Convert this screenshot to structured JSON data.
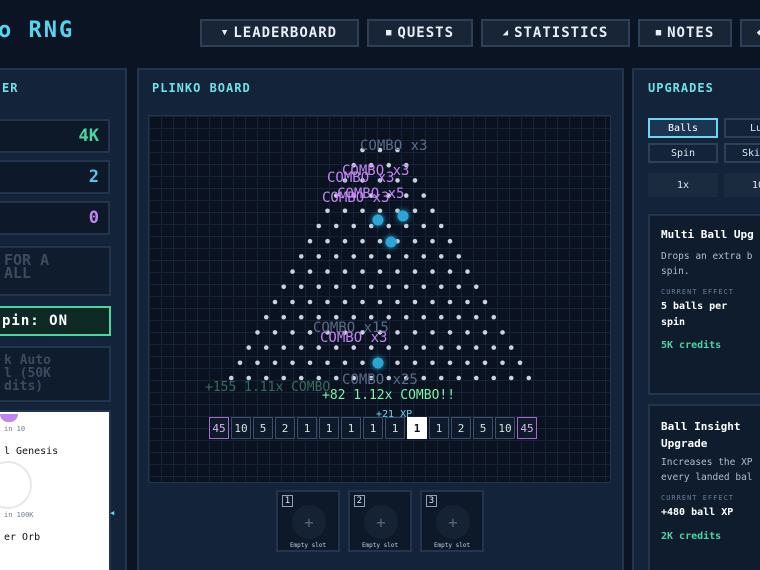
{
  "header": {
    "logo": "o RNG",
    "nav": [
      {
        "label": "LEADERBOARD",
        "icon": "trophy-icon"
      },
      {
        "label": "QUESTS",
        "icon": "scroll-icon"
      },
      {
        "label": "STATISTICS",
        "icon": "chart-icon"
      },
      {
        "label": "NOTES",
        "icon": "note-icon"
      },
      {
        "label": "",
        "icon": "chat-icon"
      }
    ]
  },
  "left_panel": {
    "title": "ER",
    "stats": [
      "4K",
      "2",
      "0"
    ],
    "spin_box": "FOR A\nALL",
    "auto_spin": "pin: ON",
    "auto_unlock": "k Auto\nl (50K\ndits)",
    "orbs": [
      {
        "sub": "in 10",
        "name": "l Genesis"
      },
      {
        "sub": "in 100K",
        "name": "er Orb"
      }
    ]
  },
  "board": {
    "title": "PLINKO BOARD",
    "multipliers": [
      "45",
      "10",
      "5",
      "2",
      "1",
      "1",
      "1",
      "1",
      "1",
      "1",
      "1",
      "2",
      "5",
      "10",
      "45"
    ],
    "highlighted_slot": 9,
    "combo_texts": [
      "COMBO x3",
      "COMBO x3",
      "COMBO x3",
      "COMBO x5",
      "COMBO x15",
      "COMBO x3",
      "COMBO x25"
    ],
    "reward_texts": [
      "+155 1.11x COMBO",
      "+82 1.12x COMBO!!",
      "+21 XP"
    ]
  },
  "empty_slots": [
    {
      "num": "1",
      "label": "Empty slot"
    },
    {
      "num": "2",
      "label": "Empty slot"
    },
    {
      "num": "3",
      "label": "Empty slot"
    }
  ],
  "upgrades": {
    "title": "UPGRADES",
    "tabs": [
      "Balls",
      "Lu",
      "Spin",
      "Ski"
    ],
    "qty": [
      "1x",
      "10"
    ],
    "cards": [
      {
        "title": "Multi Ball Upg",
        "desc": "Drops an extra b\nspin.",
        "effect_label": "CURRENT EFFECT",
        "effect": "5 balls per\nspin",
        "cost": "5K credits"
      },
      {
        "title": "Ball Insight\nUpgrade",
        "desc": "Increases the XP\nevery landed bal",
        "effect_label": "CURRENT EFFECT",
        "effect": "+480 ball XP",
        "cost": "2K credits"
      }
    ]
  },
  "colors": {
    "background": "#0b1422",
    "panel": "#13233a",
    "accent_cyan": "#6ee0e7",
    "accent_green": "#4ad6a2",
    "combo_purple": "#c384f3",
    "ball_blue": "#2aa6d6"
  }
}
